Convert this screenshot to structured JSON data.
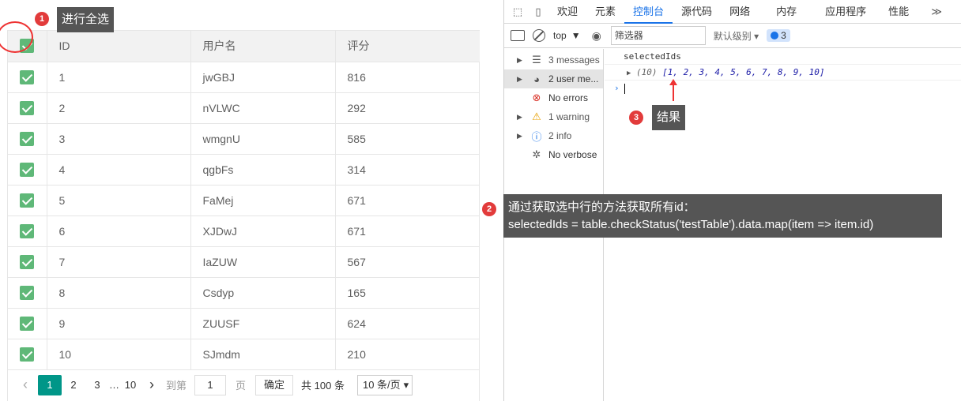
{
  "table": {
    "headers": [
      "ID",
      "用户名",
      "评分"
    ],
    "rows": [
      {
        "id": "1",
        "username": "jwGBJ",
        "score": "816"
      },
      {
        "id": "2",
        "username": "nVLWC",
        "score": "292"
      },
      {
        "id": "3",
        "username": "wmgnU",
        "score": "585"
      },
      {
        "id": "4",
        "username": "qgbFs",
        "score": "314"
      },
      {
        "id": "5",
        "username": "FaMej",
        "score": "671"
      },
      {
        "id": "6",
        "username": "XJDwJ",
        "score": "671"
      },
      {
        "id": "7",
        "username": "IaZUW",
        "score": "567"
      },
      {
        "id": "8",
        "username": "Csdyp",
        "score": "165"
      },
      {
        "id": "9",
        "username": "ZUUSF",
        "score": "624"
      },
      {
        "id": "10",
        "username": "SJmdm",
        "score": "210"
      }
    ]
  },
  "pager": {
    "prev": "‹",
    "pages": [
      "1",
      "2",
      "3"
    ],
    "ellipsis": "…",
    "last": "10",
    "next": "›",
    "goto_label": "到第",
    "goto_value": "1",
    "page_unit": "页",
    "confirm": "确定",
    "total": "共 100 条",
    "per_page": "10 条/页"
  },
  "annotations": {
    "badge1": "1",
    "note1": "进行全选",
    "badge2": "2",
    "note2_line1": "通过获取选中行的方法获取所有id：",
    "note2_line2": "selectedIds = table.checkStatus('testTable').data.map(item => item.id)",
    "badge3": "3",
    "note3": "结果"
  },
  "devtools": {
    "tabs": [
      "欢迎",
      "元素",
      "控制台",
      "源代码",
      "网络",
      "内存",
      "应用程序",
      "性能"
    ],
    "active_tab": "控制台",
    "more": "≫",
    "context": "top",
    "filter_placeholder": "筛选器",
    "level": "默认级别 ▾",
    "issue_count": "3",
    "sidebar": [
      {
        "label": "3 messages",
        "icon": "list-icon"
      },
      {
        "label": "2 user me...",
        "icon": "user-icon"
      },
      {
        "label": "No errors",
        "icon": "error-icon"
      },
      {
        "label": "1 warning",
        "icon": "warning-icon"
      },
      {
        "label": "2 info",
        "icon": "info-icon"
      },
      {
        "label": "No verbose",
        "icon": "bug-icon"
      }
    ],
    "console": {
      "line1": "selectedIds",
      "array_len": "(10)",
      "array_values": "[1, 2, 3, 4, 5, 6, 7, 8, 9, 10]"
    }
  },
  "colors": {
    "checkbox": "#5fb878",
    "pager_current": "#009688",
    "annotation_red": "#e23b3b",
    "tooltip_bg": "#555555",
    "devtools_accent": "#1a73e8"
  }
}
